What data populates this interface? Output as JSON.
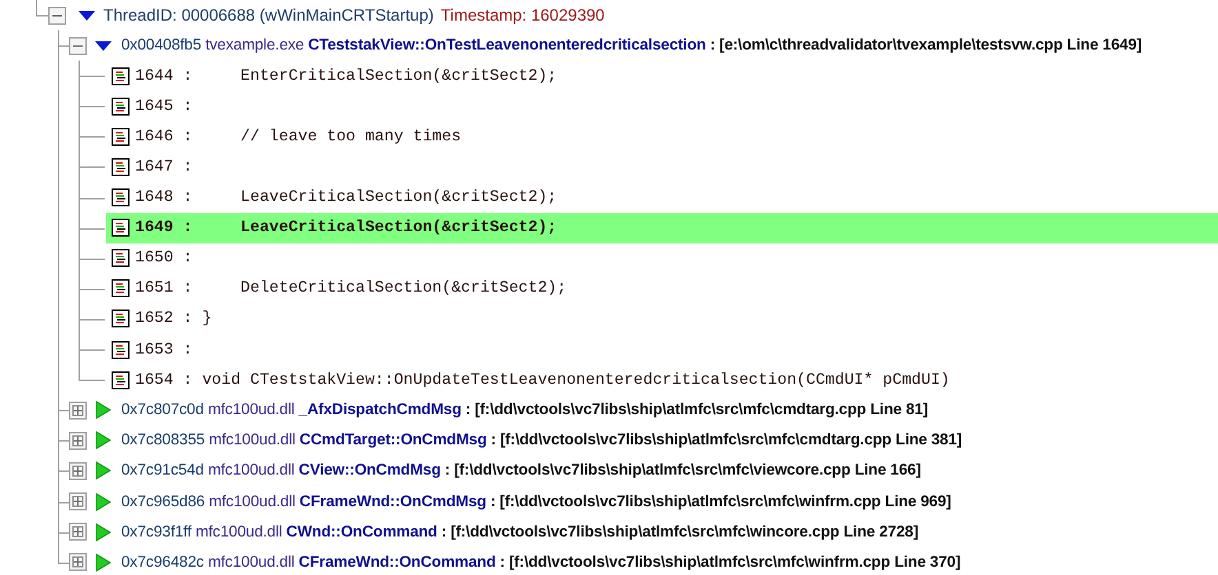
{
  "thread": {
    "name": "ThreadID: 00006688 (wWinMainCRTStartup)",
    "timestamp": "Timestamp: 16029390",
    "expanded": true,
    "frames": [
      {
        "address": "0x00408fb5",
        "module": "tvexample.exe",
        "function": "CTeststakView::OnTestLeavenonenteredcriticalsection",
        "location": ": [e:\\om\\c\\threadvalidator\\tvexample\\testsvw.cpp Line 1649]",
        "expanded": true,
        "lines": [
          {
            "text": "1644 :     EnterCriticalSection(&critSect2);",
            "selected": false
          },
          {
            "text": "1645 :",
            "selected": false
          },
          {
            "text": "1646 :     // leave too many times",
            "selected": false
          },
          {
            "text": "1647 :",
            "selected": false
          },
          {
            "text": "1648 :     LeaveCriticalSection(&critSect2);",
            "selected": false
          },
          {
            "text": "1649 :     LeaveCriticalSection(&critSect2);",
            "selected": true
          },
          {
            "text": "1650 :",
            "selected": false
          },
          {
            "text": "1651 :     DeleteCriticalSection(&critSect2);",
            "selected": false
          },
          {
            "text": "1652 : }",
            "selected": false
          },
          {
            "text": "1653 :",
            "selected": false
          },
          {
            "text": "1654 : void CTeststakView::OnUpdateTestLeavenonenteredcriticalsection(CCmdUI* pCmdUI)",
            "selected": false
          }
        ]
      },
      {
        "address": "0x7c807c0d",
        "module": "mfc100ud.dll",
        "function": "_AfxDispatchCmdMsg",
        "location": ": [f:\\dd\\vctools\\vc7libs\\ship\\atlmfc\\src\\mfc\\cmdtarg.cpp Line 81]",
        "expanded": false
      },
      {
        "address": "0x7c808355",
        "module": "mfc100ud.dll",
        "function": "CCmdTarget::OnCmdMsg",
        "location": ": [f:\\dd\\vctools\\vc7libs\\ship\\atlmfc\\src\\mfc\\cmdtarg.cpp Line 381]",
        "expanded": false
      },
      {
        "address": "0x7c91c54d",
        "module": "mfc100ud.dll",
        "function": "CView::OnCmdMsg",
        "location": ": [f:\\dd\\vctools\\vc7libs\\ship\\atlmfc\\src\\mfc\\viewcore.cpp Line 166]",
        "expanded": false
      },
      {
        "address": "0x7c965d86",
        "module": "mfc100ud.dll",
        "function": "CFrameWnd::OnCmdMsg",
        "location": ": [f:\\dd\\vctools\\vc7libs\\ship\\atlmfc\\src\\mfc\\winfrm.cpp Line 969]",
        "expanded": false
      },
      {
        "address": "0x7c93f1ff",
        "module": "mfc100ud.dll",
        "function": "CWnd::OnCommand",
        "location": ": [f:\\dd\\vctools\\vc7libs\\ship\\atlmfc\\src\\mfc\\wincore.cpp Line 2728]",
        "expanded": false
      },
      {
        "address": "0x7c96482c",
        "module": "mfc100ud.dll",
        "function": "CFrameWnd::OnCommand",
        "location": ": [f:\\dd\\vctools\\vc7libs\\ship\\atlmfc\\src\\mfc\\winfrm.cpp Line 370]",
        "expanded": false
      }
    ]
  }
}
